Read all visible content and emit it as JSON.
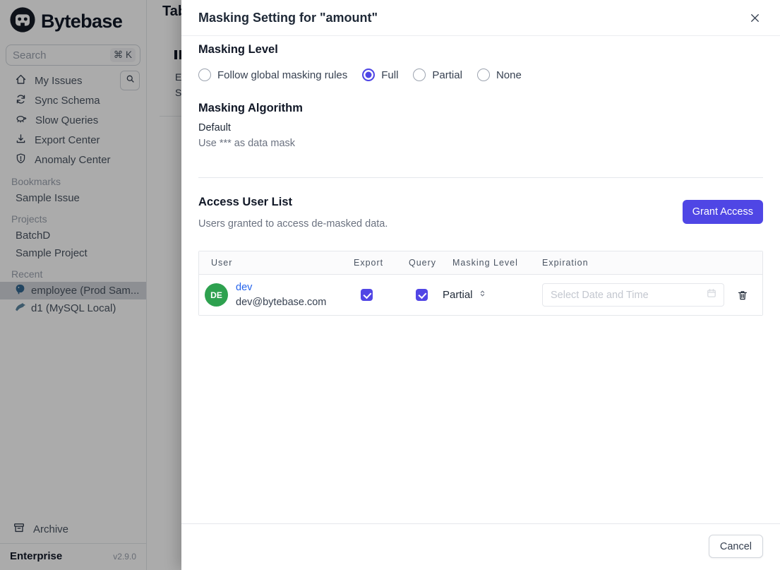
{
  "accent_color": "#4f46e5",
  "sidebar": {
    "brand": "Bytebase",
    "search": {
      "placeholder": "Search",
      "shortcut": "⌘ K"
    },
    "nav": [
      {
        "label": "My Issues",
        "icon": "home-icon"
      },
      {
        "label": "Sync Schema",
        "icon": "sync-icon"
      },
      {
        "label": "Slow Queries",
        "icon": "turtle-icon"
      },
      {
        "label": "Export Center",
        "icon": "download-icon"
      },
      {
        "label": "Anomaly Center",
        "icon": "shield-icon"
      }
    ],
    "sections": [
      {
        "title": "Bookmarks",
        "items": [
          {
            "label": "Sample Issue"
          }
        ]
      },
      {
        "title": "Projects",
        "items": [
          {
            "label": "BatchD"
          },
          {
            "label": "Sample Project"
          }
        ]
      },
      {
        "title": "Recent",
        "items": [
          {
            "label": "employee (Prod Sam...",
            "icon": "postgresql-icon",
            "selected": true
          },
          {
            "label": "d1 (MySQL Local)",
            "icon": "mysql-icon",
            "selected": false
          }
        ]
      }
    ],
    "archive_label": "Archive",
    "plan": "Enterprise",
    "version": "v2.9.0"
  },
  "background_page": {
    "title_fragment": "Tab",
    "fragments": [
      "E",
      "S"
    ]
  },
  "modal": {
    "title": "Masking Setting for \"amount\"",
    "masking_level": {
      "heading": "Masking Level",
      "options": [
        {
          "label": "Follow global masking rules",
          "selected": false
        },
        {
          "label": "Full",
          "selected": true
        },
        {
          "label": "Partial",
          "selected": false
        },
        {
          "label": "None",
          "selected": false
        }
      ]
    },
    "masking_algorithm": {
      "heading": "Masking Algorithm",
      "name": "Default",
      "description": "Use *** as data mask"
    },
    "access_user_list": {
      "heading": "Access User List",
      "subtitle": "Users granted to access de-masked data.",
      "grant_button_label": "Grant Access",
      "table": {
        "columns": {
          "user": "User",
          "export": "Export",
          "query": "Query",
          "masking_level": "Masking Level",
          "expiration": "Expiration"
        },
        "rows": [
          {
            "name": "dev",
            "email": "dev@bytebase.com",
            "avatar_initials": "DE",
            "avatar_color": "#2ea14f",
            "export_checked": true,
            "query_checked": true,
            "masking_level": "Partial",
            "expiration_value": "",
            "expiration_placeholder": "Select Date and Time"
          }
        ]
      }
    },
    "footer": {
      "cancel_label": "Cancel"
    }
  }
}
